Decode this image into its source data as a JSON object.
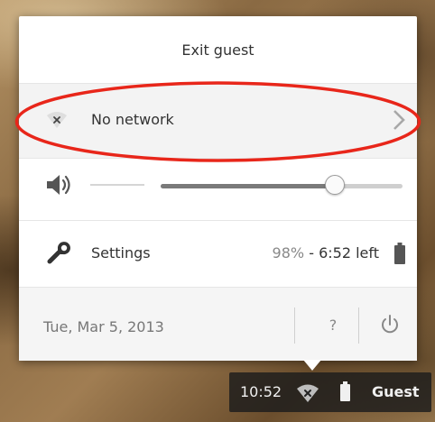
{
  "menu": {
    "exit_guest_label": "Exit guest",
    "network": {
      "label": "No network",
      "icon": "wifi-disconnected-icon"
    },
    "volume": {
      "icon": "speaker-icon",
      "level": 0.72
    },
    "settings": {
      "label": "Settings",
      "icon": "wrench-icon",
      "battery_percent": "98%",
      "battery_separator": "-",
      "battery_time": "6:52 left"
    },
    "footer": {
      "date": "Tue, Mar 5, 2013",
      "help_label": "?",
      "power_icon": "power-icon"
    }
  },
  "tray": {
    "time": "10:52",
    "user": "Guest"
  },
  "colors": {
    "highlight": "#e8261a",
    "tray_bg": "#1c1c1c",
    "panel_bg": "#ffffff"
  }
}
